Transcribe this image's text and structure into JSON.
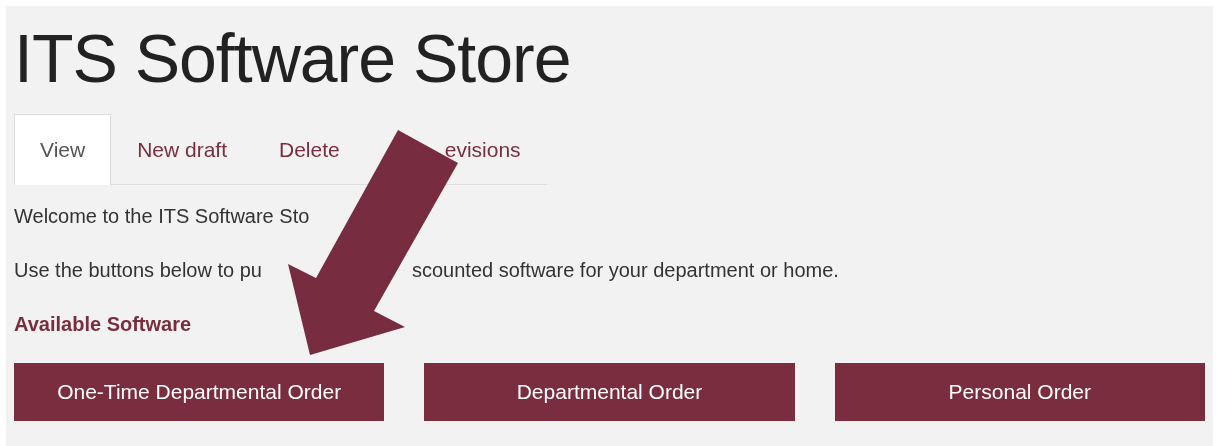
{
  "page_title": "ITS Software Store",
  "tabs": [
    {
      "label": "View",
      "selected": true
    },
    {
      "label": "New draft",
      "selected": false
    },
    {
      "label": "Delete",
      "selected": false
    },
    {
      "label": "evisions",
      "selected": false
    }
  ],
  "intro": "Welcome to the ITS Software Sto",
  "instructions": [
    "Use the buttons below to pu",
    "scounted software for your department or home."
  ],
  "section_heading": "Available Software",
  "buttons": [
    "One-Time Departmental Order",
    "Departmental Order",
    "Personal Order"
  ]
}
